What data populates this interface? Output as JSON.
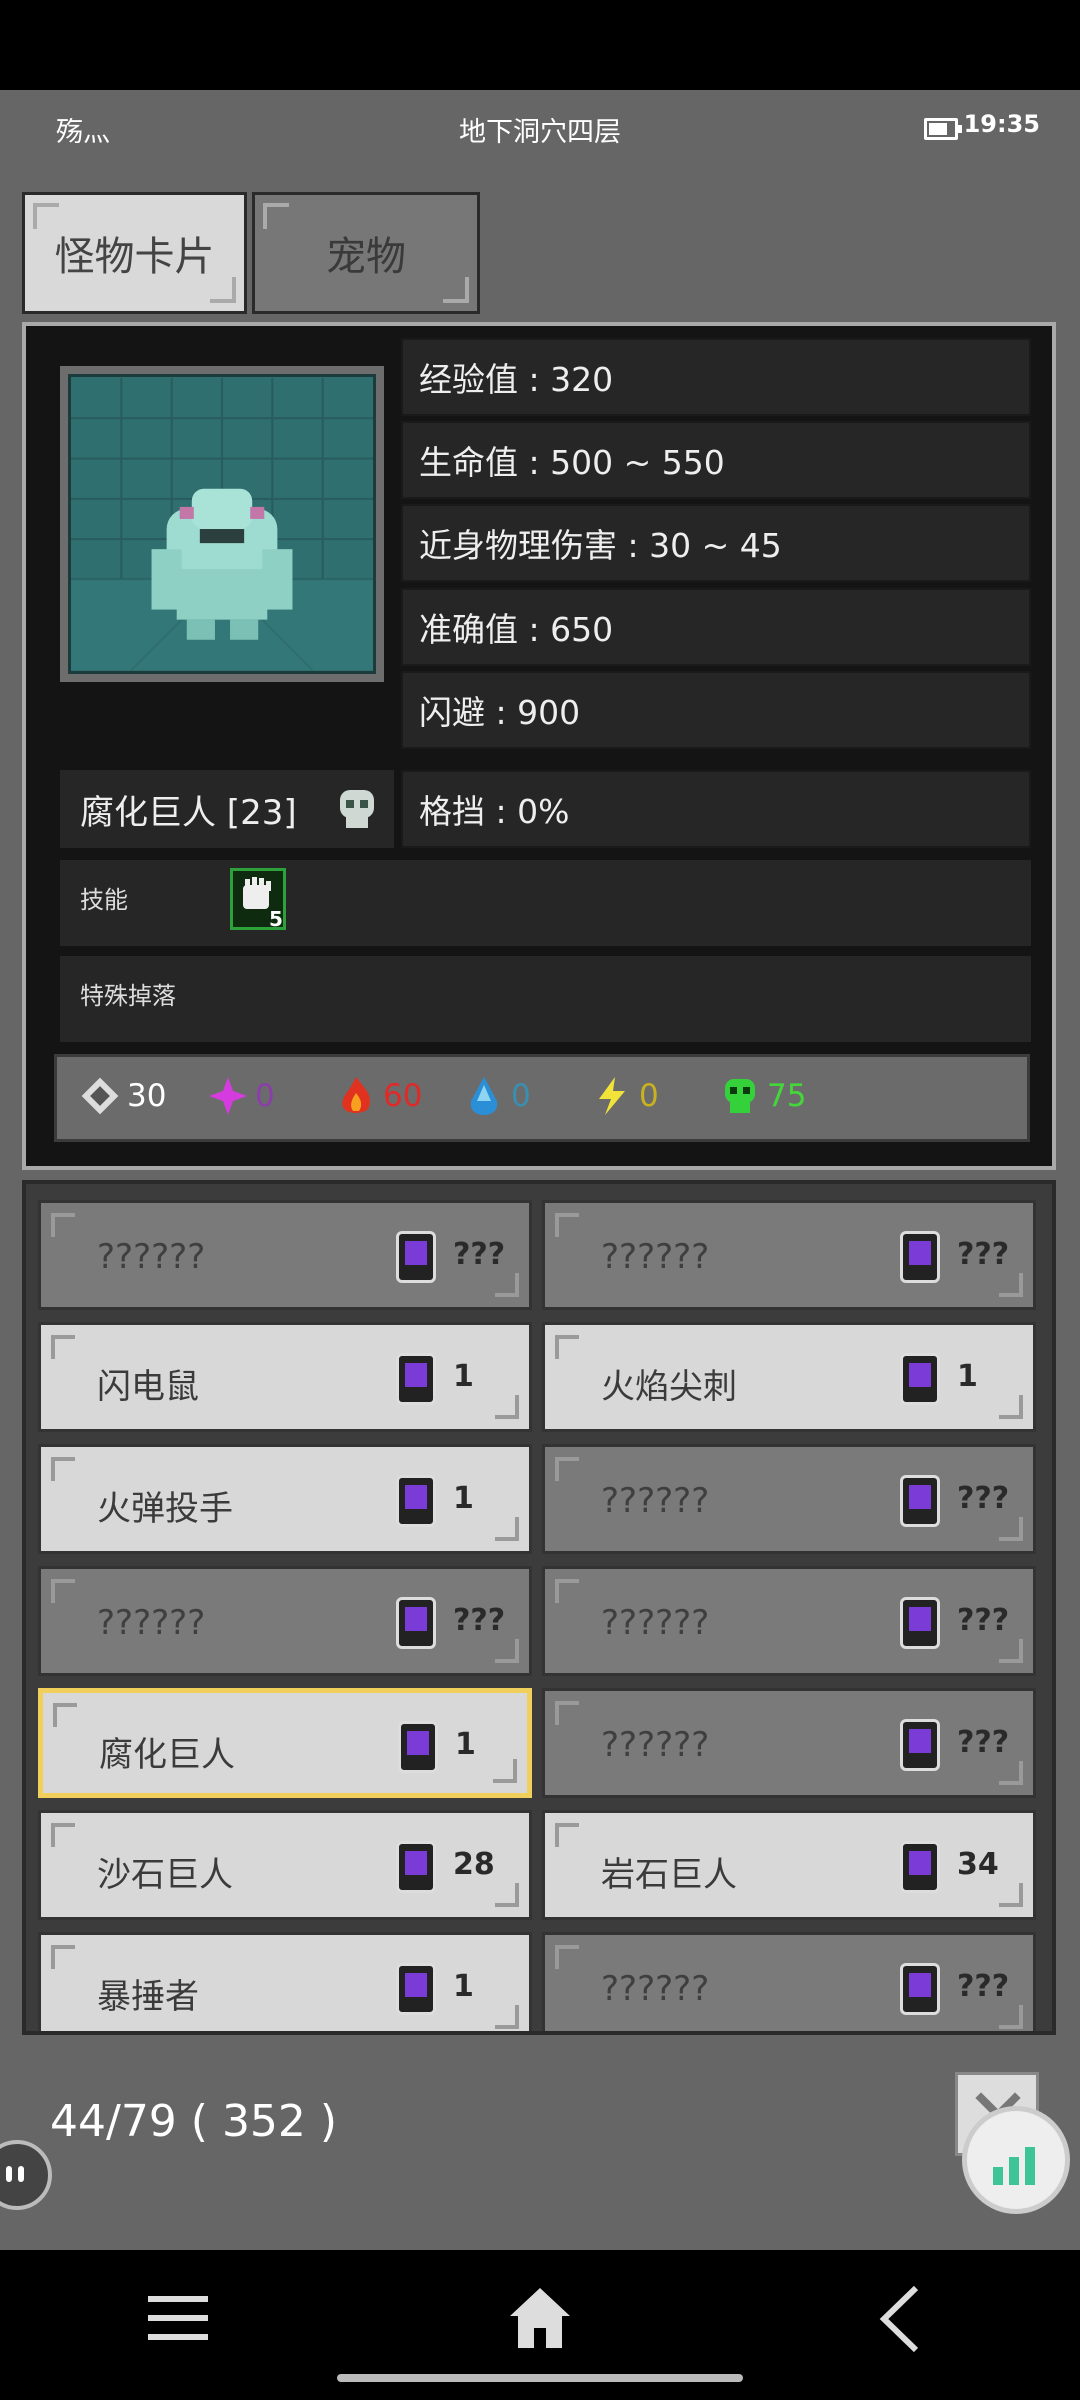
{
  "status": {
    "left_text": "殇灬",
    "title": "地下洞穴四层",
    "time": "19:35",
    "battery_icon": "battery-icon"
  },
  "tabs": [
    {
      "label": "怪物卡片",
      "active": true
    },
    {
      "label": "宠物",
      "active": false
    }
  ],
  "monster": {
    "name": "腐化巨人 [23]",
    "stats": [
      "经验值 : 320",
      "生命值 : 500 ~ 550",
      "近身物理伤害 : 30 ~ 45",
      "准确值 : 650",
      "闪避 : 900",
      "格挡 : 0%"
    ],
    "skills_label": "技能",
    "skill_level": "5",
    "special_drop_label": "特殊掉落",
    "resistances": [
      {
        "icon": "physical-icon",
        "value": "30",
        "color": "#ffffff"
      },
      {
        "icon": "arcane-icon",
        "value": "0",
        "color": "#8a3fa8"
      },
      {
        "icon": "fire-icon",
        "value": "60",
        "color": "#e02a2a"
      },
      {
        "icon": "ice-icon",
        "value": "0",
        "color": "#3a8fb0"
      },
      {
        "icon": "lightning-icon",
        "value": "0",
        "color": "#c8b21e"
      },
      {
        "icon": "poison-icon",
        "value": "75",
        "color": "#45d63a"
      }
    ]
  },
  "cards": [
    {
      "name": "??????",
      "count": "???",
      "state": "unknown"
    },
    {
      "name": "??????",
      "count": "???",
      "state": "unknown"
    },
    {
      "name": "闪电鼠",
      "count": "1",
      "state": "known"
    },
    {
      "name": "火焰尖刺",
      "count": "1",
      "state": "known"
    },
    {
      "name": "火弹投手",
      "count": "1",
      "state": "known"
    },
    {
      "name": "??????",
      "count": "???",
      "state": "unknown"
    },
    {
      "name": "??????",
      "count": "???",
      "state": "unknown"
    },
    {
      "name": "??????",
      "count": "???",
      "state": "unknown"
    },
    {
      "name": "腐化巨人",
      "count": "1",
      "state": "selected"
    },
    {
      "name": "??????",
      "count": "???",
      "state": "unknown"
    },
    {
      "name": "沙石巨人",
      "count": "28",
      "state": "known"
    },
    {
      "name": "岩石巨人",
      "count": "34",
      "state": "known"
    },
    {
      "name": "暴捶者",
      "count": "1",
      "state": "known"
    },
    {
      "name": "??????",
      "count": "???",
      "state": "unknown"
    }
  ],
  "footer": {
    "progress": "44/79 ( 352 )"
  }
}
